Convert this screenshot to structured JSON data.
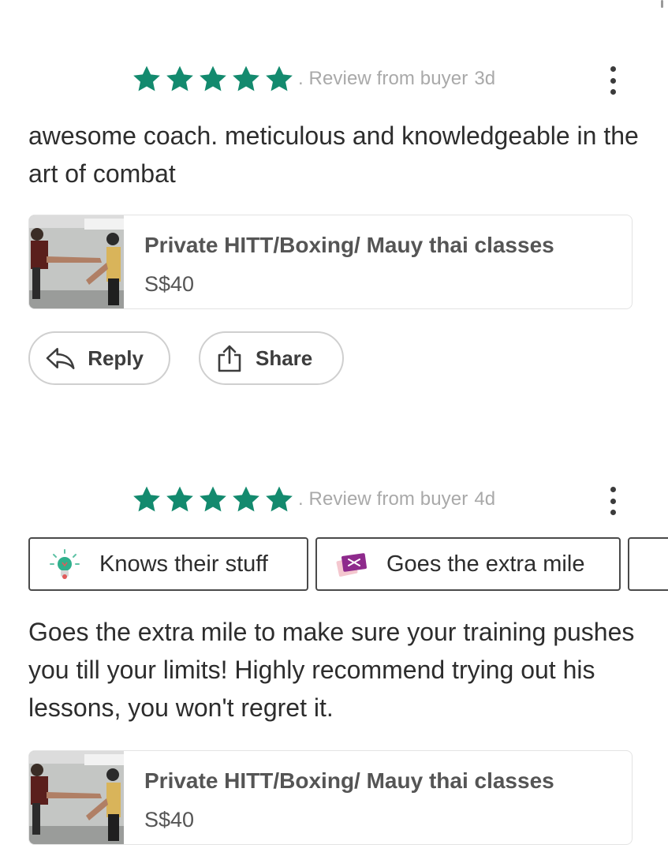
{
  "colors": {
    "star": "#138a6e",
    "meta": "#a9a9a9",
    "border": "#e3e3e3",
    "text": "#2d2d2d"
  },
  "reviews": [
    {
      "stars": 5,
      "meta_label": ". Review from buyer",
      "age": "3d",
      "text": "awesome coach. meticulous and knowledgeable in the art of combat",
      "listing": {
        "title": "Private HITT/Boxing/ Mauy thai classes",
        "price": "S$40"
      },
      "actions": {
        "reply": "Reply",
        "share": "Share"
      }
    },
    {
      "stars": 5,
      "meta_label": ". Review from buyer",
      "age": "4d",
      "tags": [
        {
          "label": "Knows their stuff",
          "icon": "lightbulb-icon"
        },
        {
          "label": "Goes the extra mile",
          "icon": "ticket-icon"
        }
      ],
      "text": "Goes the extra mile to make sure your training pushes you till your limits! Highly recommend trying out his lessons, you won't regret it.",
      "listing": {
        "title": "Private HITT/Boxing/ Mauy thai classes",
        "price": "S$40"
      }
    }
  ]
}
